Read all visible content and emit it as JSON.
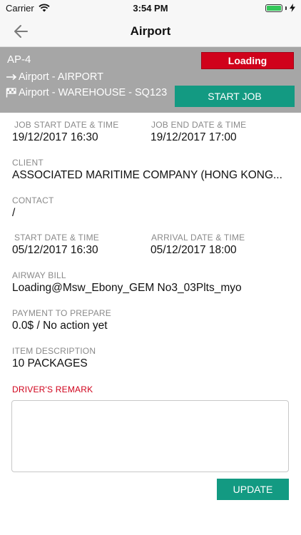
{
  "status_bar": {
    "carrier": "Carrier",
    "time": "3:54 PM"
  },
  "navbar": {
    "title": "Airport"
  },
  "job": {
    "code": "AP-4",
    "route_from": "Airport - AIRPORT",
    "route_to": "Airport - WAREHOUSE - SQ123",
    "status": "Loading",
    "start_button": "START JOB"
  },
  "fields": {
    "job_start_label": "JOB START DATE & TIME",
    "job_start_value": "19/12/2017 16:30",
    "job_end_label": "JOB END DATE & TIME",
    "job_end_value": "19/12/2017 17:00",
    "client_label": "CLIENT",
    "client_value": "ASSOCIATED MARITIME COMPANY (HONG KONG...",
    "contact_label": "CONTACT",
    "contact_value": " /",
    "start_label": "START DATE & TIME",
    "start_value": "05/12/2017 16:30",
    "arrival_label": "ARRIVAL DATE & TIME",
    "arrival_value": "05/12/2017 18:00",
    "airway_label": "AIRWAY BILL",
    "airway_value": "Loading@Msw_Ebony_GEM No3_03Plts_myo",
    "payment_label": "PAYMENT TO PREPARE",
    "payment_value": "0.0$ / No action yet",
    "item_label": "ITEM DESCRIPTION",
    "item_value": "10 PACKAGES"
  },
  "remark": {
    "label": "DRIVER'S REMARK",
    "value": ""
  },
  "update_button": "UPDATE",
  "colors": {
    "accent": "#139a82",
    "status_red": "#d0021b",
    "header_gray": "#a6a6a6",
    "battery_green": "#34c759"
  }
}
